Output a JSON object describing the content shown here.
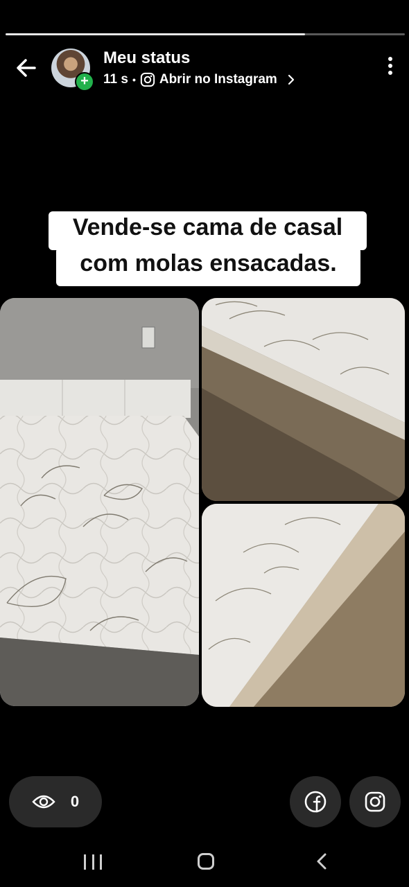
{
  "status_progress": 0.75,
  "header": {
    "title": "Meu status",
    "time": "11 s",
    "separator": "•",
    "open_instagram": "Abrir no Instagram",
    "avatar_badge": "+"
  },
  "caption": {
    "line1": "Vende-se cama de casal",
    "line2": "com molas ensacadas."
  },
  "footer": {
    "views_count": "0"
  },
  "icons": {
    "back": "arrow-left-icon",
    "menu": "more-vertical-icon",
    "views": "eye-icon",
    "facebook": "facebook-icon",
    "instagram": "instagram-icon"
  },
  "colors": {
    "background": "#000000",
    "pill": "#2a2a2a",
    "add_badge": "#22b14c"
  }
}
